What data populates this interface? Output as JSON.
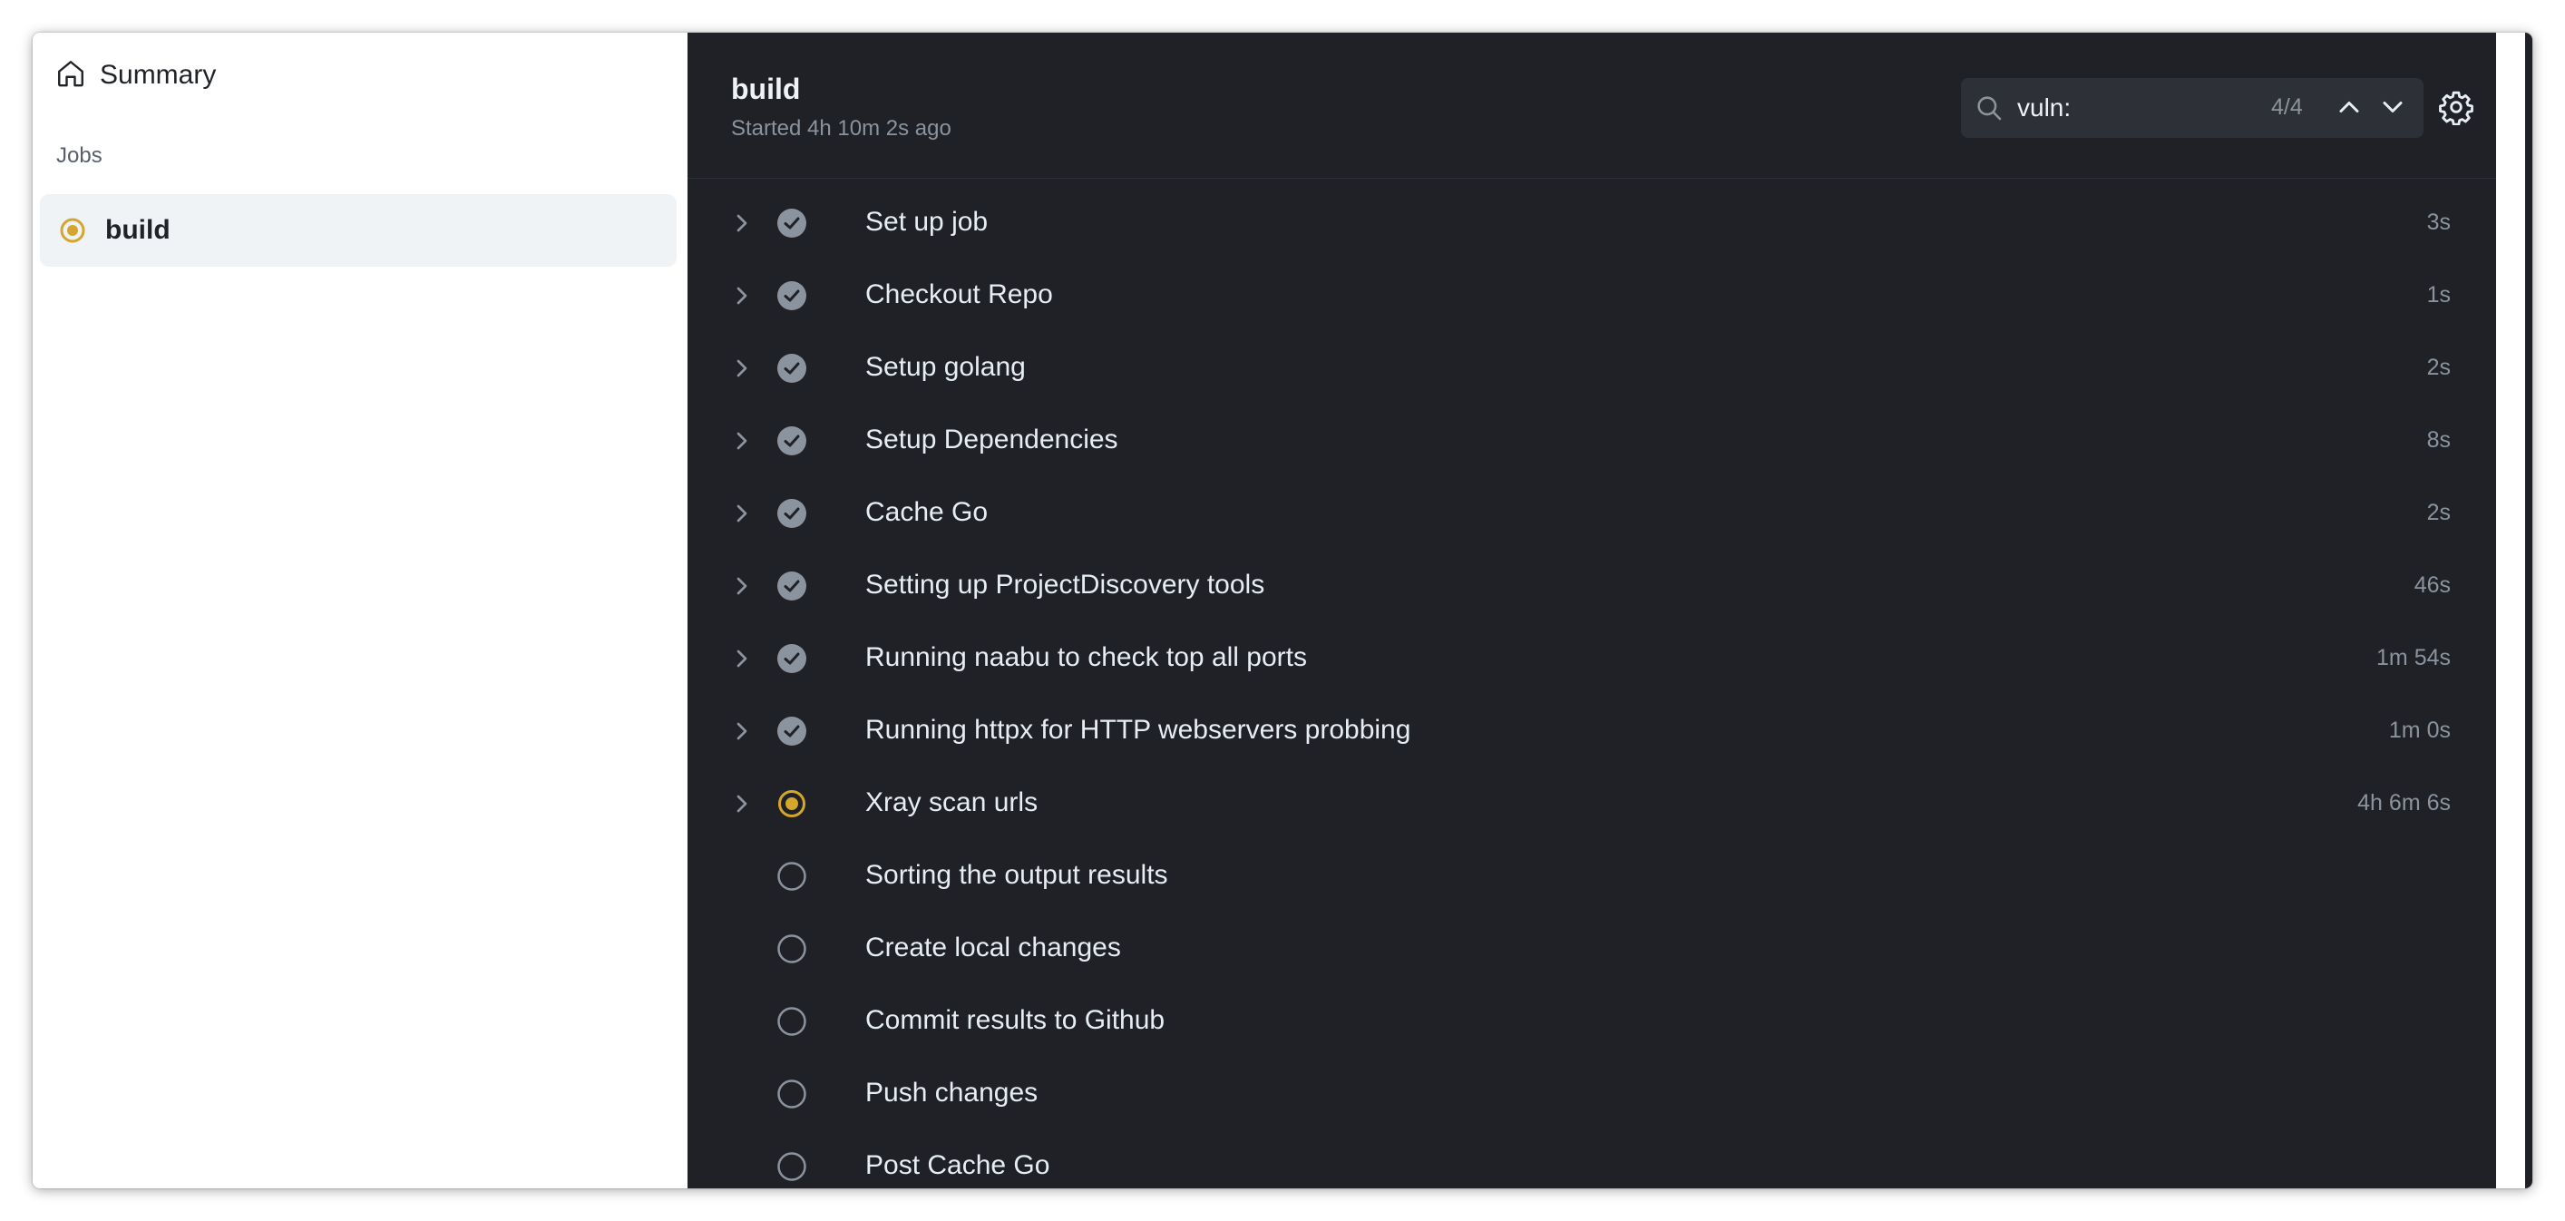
{
  "sidebar": {
    "summary_label": "Summary",
    "jobs_heading": "Jobs",
    "job": {
      "label": "build",
      "status": "in-progress"
    }
  },
  "header": {
    "title": "build",
    "subtitle": "Started 4h 10m 2s ago"
  },
  "search": {
    "value": "vuln:",
    "match_count": "4/4"
  },
  "icons": {
    "home": "home-icon",
    "search": "search-icon",
    "prev": "chevron-up-icon",
    "next": "chevron-down-icon",
    "settings": "gear-icon",
    "expand": "chevron-right-icon",
    "success": "check-circle-icon",
    "in_progress": "in-progress-icon",
    "pending": "pending-circle-icon"
  },
  "colors": {
    "panel_bg": "#1f2126",
    "success": "#8b949e",
    "in_progress": "#d4a72c",
    "pending": "#8b949e"
  },
  "steps": [
    {
      "name": "Set up job",
      "duration": "3s",
      "status": "success",
      "expandable": true
    },
    {
      "name": "Checkout Repo",
      "duration": "1s",
      "status": "success",
      "expandable": true
    },
    {
      "name": "Setup golang",
      "duration": "2s",
      "status": "success",
      "expandable": true
    },
    {
      "name": "Setup Dependencies",
      "duration": "8s",
      "status": "success",
      "expandable": true
    },
    {
      "name": "Cache Go",
      "duration": "2s",
      "status": "success",
      "expandable": true
    },
    {
      "name": "Setting up ProjectDiscovery tools",
      "duration": "46s",
      "status": "success",
      "expandable": true
    },
    {
      "name": "Running naabu to check top all ports",
      "duration": "1m 54s",
      "status": "success",
      "expandable": true
    },
    {
      "name": "Running httpx for HTTP webservers probbing",
      "duration": "1m 0s",
      "status": "success",
      "expandable": true
    },
    {
      "name": "Xray scan urls",
      "duration": "4h 6m 6s",
      "status": "in_progress",
      "expandable": true
    },
    {
      "name": "Sorting the output results",
      "duration": "",
      "status": "pending",
      "expandable": false
    },
    {
      "name": "Create local changes",
      "duration": "",
      "status": "pending",
      "expandable": false
    },
    {
      "name": "Commit results to Github",
      "duration": "",
      "status": "pending",
      "expandable": false
    },
    {
      "name": "Push changes",
      "duration": "",
      "status": "pending",
      "expandable": false
    },
    {
      "name": "Post Cache Go",
      "duration": "",
      "status": "pending",
      "expandable": false
    }
  ]
}
